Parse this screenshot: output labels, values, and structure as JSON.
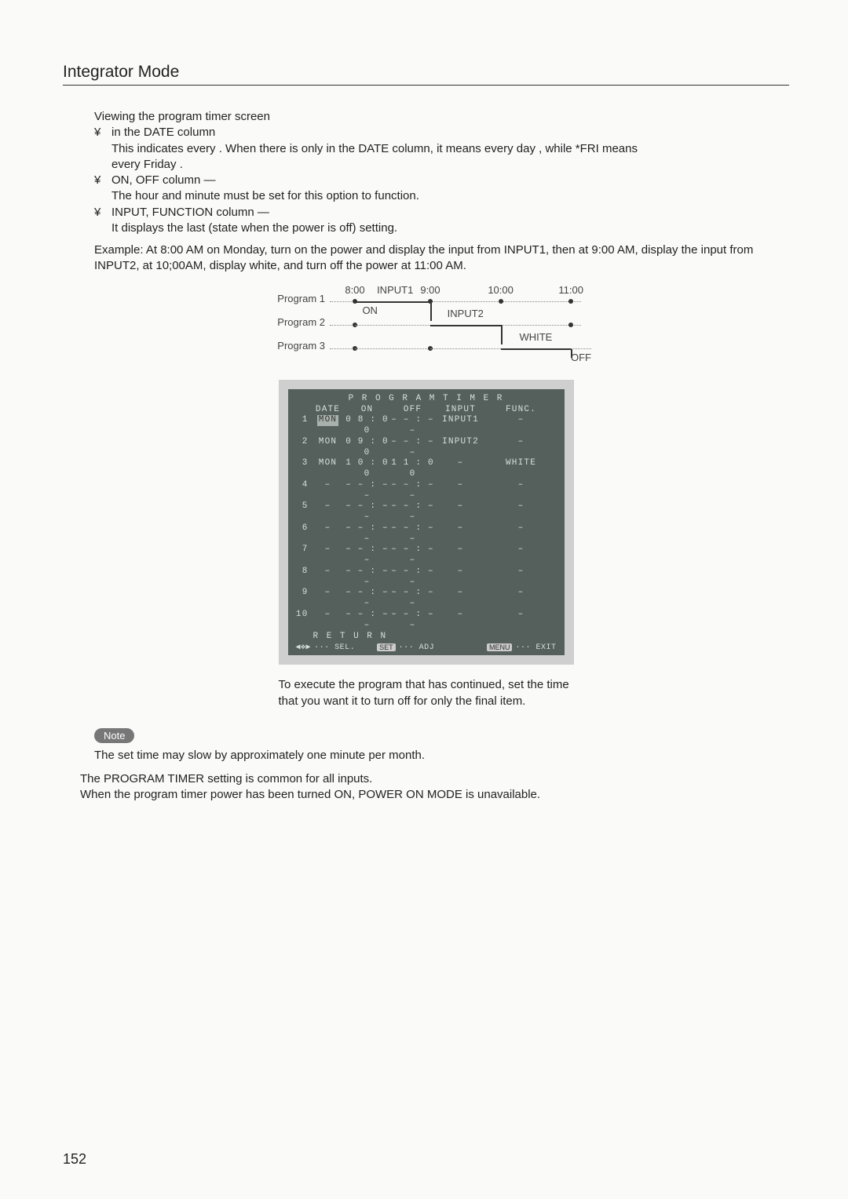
{
  "sectionTitle": "Integrator Mode",
  "intro": "Viewing the program timer screen",
  "bullets": {
    "b1": {
      "title": "  in the DATE column",
      "line1a": "This indicates  every  . When there is only ",
      "line1b": " in the DATE column, it means  every day  , while   *FRI   means",
      "line2": " every Friday  ."
    },
    "b2": {
      "title": "ON, OFF column  —",
      "line": "The hour and minute must be set for this option to function."
    },
    "b3": {
      "title": "INPUT, FUNCTION column  —",
      "line": "It displays the   last   (state when the power is off) setting."
    }
  },
  "example": "Example: At 8:00 AM on Monday, turn on the power and display the input from INPUT1, then at 9:00 AM, display the input from INPUT2, at 10;00AM, display white, and turn off the power at 11:00 AM.",
  "timeline": {
    "rows": [
      "Program 1",
      "Program 2",
      "Program 3"
    ],
    "ticks": [
      "8:00",
      "9:00",
      "10:00",
      "11:00"
    ],
    "labels": {
      "input1": "INPUT1",
      "input2": "INPUT2",
      "white": "WHITE",
      "on": "ON",
      "off": "OFF"
    }
  },
  "menu": {
    "title": "P R O G R A M   T I M E R",
    "headers": {
      "date": "DATE",
      "on": "ON",
      "off": "OFF",
      "input": "INPUT",
      "func": "FUNC."
    },
    "rows": [
      {
        "n": "1",
        "date": "MON",
        "on": "0 8 : 0 0",
        "off": "– – : – –",
        "input": "INPUT1",
        "func": "–",
        "hl": true
      },
      {
        "n": "2",
        "date": "MON",
        "on": "0 9 : 0 0",
        "off": "– – : – –",
        "input": "INPUT2",
        "func": "–"
      },
      {
        "n": "3",
        "date": "MON",
        "on": "1 0 : 0 0",
        "off": "1 1 : 0 0",
        "input": "–",
        "func": "WHITE"
      },
      {
        "n": "4",
        "date": "–",
        "on": "– – : – –",
        "off": "– – : – –",
        "input": "–",
        "func": "–"
      },
      {
        "n": "5",
        "date": "–",
        "on": "– – : – –",
        "off": "– – : – –",
        "input": "–",
        "func": "–"
      },
      {
        "n": "6",
        "date": "–",
        "on": "– – : – –",
        "off": "– – : – –",
        "input": "–",
        "func": "–"
      },
      {
        "n": "7",
        "date": "–",
        "on": "– – : – –",
        "off": "– – : – –",
        "input": "–",
        "func": "–"
      },
      {
        "n": "8",
        "date": "–",
        "on": "– – : – –",
        "off": "– – : – –",
        "input": "–",
        "func": "–"
      },
      {
        "n": "9",
        "date": "–",
        "on": "– – : – –",
        "off": "– – : – –",
        "input": "–",
        "func": "–"
      },
      {
        "n": "10",
        "date": "–",
        "on": "– – : – –",
        "off": "– – : – –",
        "input": "–",
        "func": "–"
      }
    ],
    "return": "R E T U R N",
    "footer": {
      "sel": "··· SEL.",
      "adj": "··· ADJ",
      "adjKey": "SET",
      "exit": "··· EXIT",
      "exitKey": "MENU",
      "arrows": "◀✥▶"
    }
  },
  "caption": "To execute the program that has continued, set the time that you want it to turn off for only the final item.",
  "noteLabel": "Note",
  "noteText": "The set time may slow by approximately one minute per month.",
  "tail1": "The  PROGRAM TIMER  setting is common for all inputs.",
  "tail2": "When the program timer power has been turned ON,   POWER ON MODE   is unavailable.",
  "pageNum": "152",
  "chart_data": {
    "type": "table",
    "title": "PROGRAM TIMER",
    "columns": [
      "#",
      "DATE",
      "ON",
      "OFF",
      "INPUT",
      "FUNC."
    ],
    "rows": [
      [
        1,
        "MON",
        "08:00",
        "--:--",
        "INPUT1",
        "-"
      ],
      [
        2,
        "MON",
        "09:00",
        "--:--",
        "INPUT2",
        "-"
      ],
      [
        3,
        "MON",
        "10:00",
        "11:00",
        "-",
        "WHITE"
      ],
      [
        4,
        "-",
        "--:--",
        "--:--",
        "-",
        "-"
      ],
      [
        5,
        "-",
        "--:--",
        "--:--",
        "-",
        "-"
      ],
      [
        6,
        "-",
        "--:--",
        "--:--",
        "-",
        "-"
      ],
      [
        7,
        "-",
        "--:--",
        "--:--",
        "-",
        "-"
      ],
      [
        8,
        "-",
        "--:--",
        "--:--",
        "-",
        "-"
      ],
      [
        9,
        "-",
        "--:--",
        "--:--",
        "-",
        "-"
      ],
      [
        10,
        "-",
        "--:--",
        "--:--",
        "-",
        "-"
      ]
    ]
  }
}
